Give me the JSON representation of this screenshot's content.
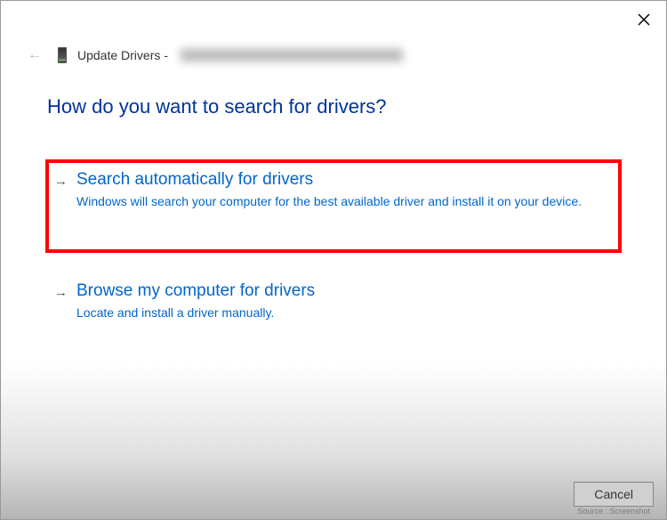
{
  "header": {
    "title_prefix": "Update Drivers - ",
    "device_name_obscured": true
  },
  "main": {
    "question": "How do you want to search for drivers?",
    "options": [
      {
        "title": "Search automatically for drivers",
        "description": "Windows will search your computer for the best available driver and install it on your device.",
        "highlighted": true
      },
      {
        "title": "Browse my computer for drivers",
        "description": "Locate and install a driver manually.",
        "highlighted": false
      }
    ]
  },
  "footer": {
    "cancel_label": "Cancel"
  },
  "source_label": "Source : Screenshot"
}
